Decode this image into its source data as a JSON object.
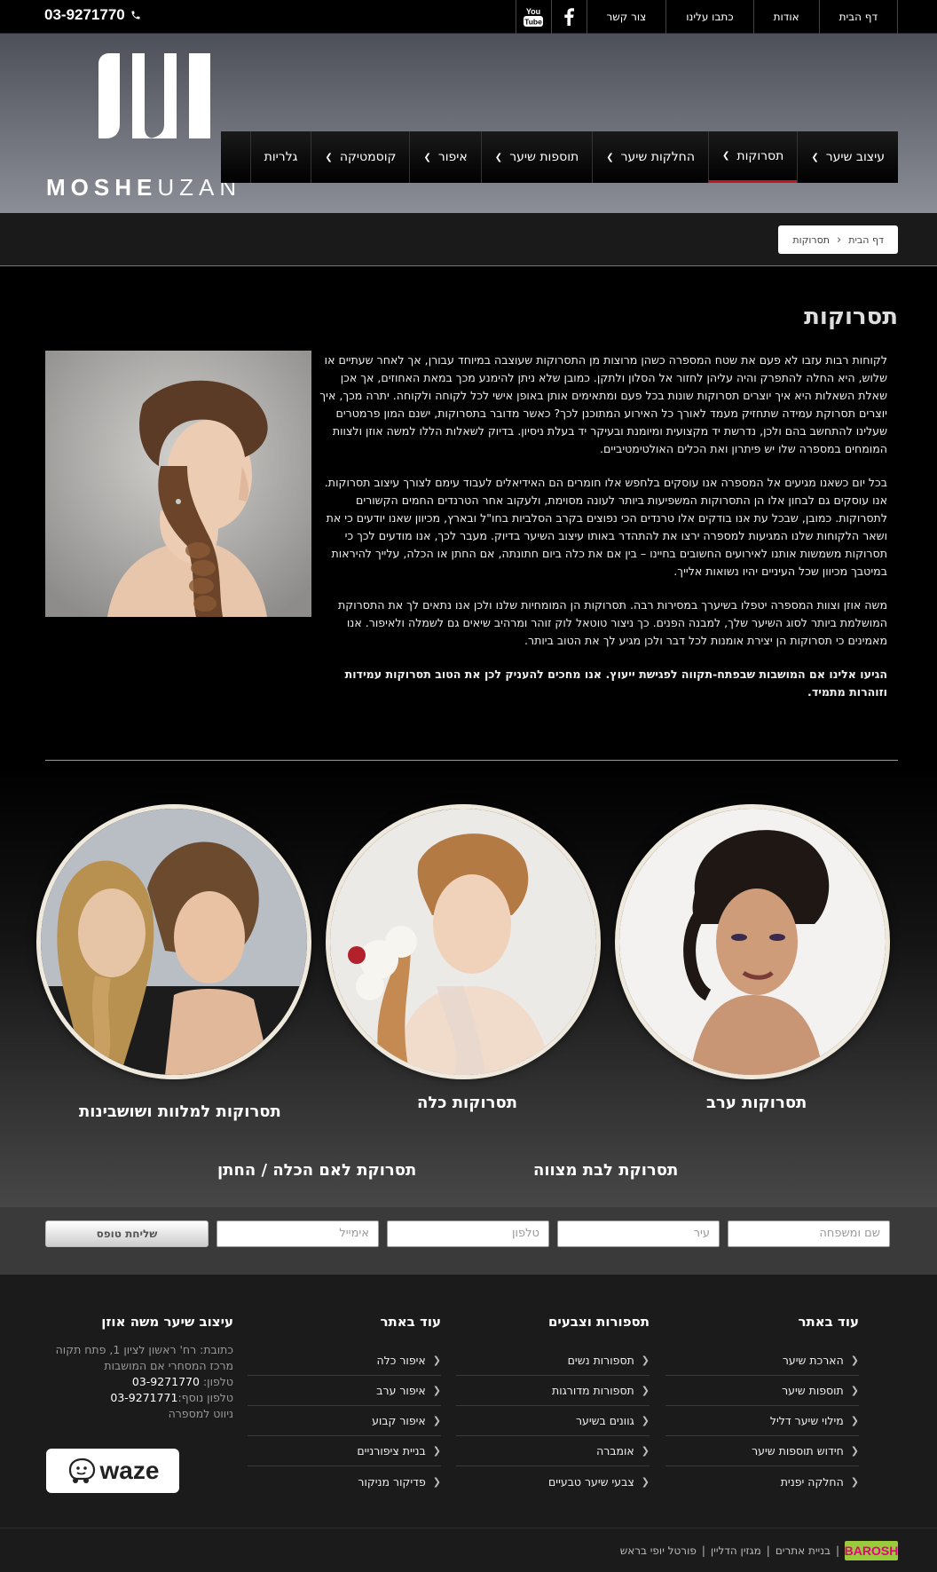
{
  "topbar": {
    "phone": "03-9271770",
    "links": [
      "דף הבית",
      "אודות",
      "כתבו עלינו",
      "צור קשר"
    ],
    "social": [
      "facebook-icon",
      "youtube-icon"
    ]
  },
  "logo": {
    "brand_bold": "MOSHE",
    "brand_thin": "UZAN"
  },
  "mainnav": {
    "items": [
      {
        "label": "עיצוב שיער",
        "has_dropdown": true
      },
      {
        "label": "תסרוקות",
        "has_dropdown": true,
        "active": true
      },
      {
        "label": "החלקות שיער",
        "has_dropdown": true
      },
      {
        "label": "תוספות שיער",
        "has_dropdown": true
      },
      {
        "label": "איפור",
        "has_dropdown": true
      },
      {
        "label": "קוסמטיקה",
        "has_dropdown": true
      },
      {
        "label": "גלריות",
        "has_dropdown": false
      }
    ],
    "active_color": "#c4161c"
  },
  "breadcrumb": {
    "home": "דף הבית",
    "current": "תסרוקות"
  },
  "content": {
    "title": "תסרוקות",
    "paragraphs": [
      "לקוחות רבות עזבו לא פעם את שטח המספרה כשהן מרוצות מן התסרוקות שעוצבה במיוחד עבורן, אך לאחר שעתיים או שלוש, היא החלה להתפרק והיה עליהן לחזור אל הסלון ולתקן. כמובן שלא ניתן להימנע מכך במאת האחוזים, אך אכן שאלת השאלות היא איך יוצרים תסרוקות שונות בכל פעם ומתאימים אותן באופן אישי לכל לקוחה ולקוחה. יתרה מכך, איך יוצרים תסרוקת עמידה שתחזיק מעמד לאורך כל האירוע המתוכנן לכך? כאשר מדובר בתסרוקות, ישנם המון פרמטרים שעלינו להתחשב בהם ולכן, נדרשת יד מקצועית ומיומנת ובעיקר יד בעלת ניסיון. בדיוק לשאלות הללו למשה אוזן ולצוות המומחים במספרה שלו יש פיתרון ואת הכלים האולטימטיביים.",
      "בכל יום כשאנו מגיעים אל המספרה אנו עוסקים בלחפש אלו חומרים הם האידיאלים לעבוד עימם לצורך עיצוב תסרוקות. אנו עוסקים גם לבחון אלו הן התסרוקות המשפיעות ביותר לעונה מסוימת, ולעקוב אחר הטרנדים החמים הקשורים לתסרוקות. כמובן, שבכל עת אנו בודקים אלו טרנדים הכי נפוצים בקרב הסלביות בחו\"ל ובארץ, מכיוון שאנו יודעים כי את ושאר הלקוחות שלנו המגיעות למספרה ירצו את להתהדר באותו עיצוב השיער בדיוק. מעבר לכך, אנו מודעים לכך כי תסרוקות משמשות אותנו לאירועים החשובים בחיינו – בין אם את כלה ביום חתונתה, אם החתן או הכלה, עלייך להיראות במיטבך מכיוון שכל העיניים יהיו נשואות אלייך.",
      "משה אוזן וצוות המספרה יטפלו בשיערך במסירות רבה. תסרוקות הן המומחיות שלנו ולכן אנו נתאים לך את התסרוקת המושלמת ביותר לסוג השיער שלך, למבנה הפנים. כך ניצור טוטאל לוק זוהר ומרהיב שיאים גם לשמלה ולאיפור. אנו מאמינים כי תסרוקות הן יצירת אומנות לכל דבר ולכן מגיע לך את הטוב ביותר.",
      "הגיעו אלינו אם המושבות שבפתח-תקווה לפגישת ייעוץ. אנו מחכים להעניק לכן את הטוב תסרוקות עמידות וזוהרות מתמיד."
    ]
  },
  "gallery": {
    "items": [
      "תסרוקות ערב",
      "תסרוקות כלה",
      "תסרוקות למלוות ושושבינות"
    ],
    "links": [
      "תסרוקת לבת מצווה",
      "תסרוקת לאם הכלה / החתן"
    ]
  },
  "form": {
    "placeholders": [
      "שם ומשפחה",
      "עיר",
      "טלפון",
      "אימייל"
    ],
    "submit": "שליחת טופס"
  },
  "footer": {
    "columns": [
      {
        "title": "עוד באתר",
        "items": [
          "הארכת שיער",
          "תוספות שיער",
          "מילוי שיער דליל",
          "חידוש תוספות שיער",
          "החלקה יפנית"
        ]
      },
      {
        "title": "תספורות וצבעים",
        "items": [
          "תספורות נשים",
          "תספורות מדורגות",
          "גוונים בשיער",
          "אומברה",
          "צבעי שיער טבעיים"
        ]
      },
      {
        "title": "עוד באתר",
        "items": [
          "איפור כלה",
          "איפור ערב",
          "איפור קבוע",
          "בניית ציפורניים",
          "פדיקור מניקור"
        ]
      }
    ],
    "contact": {
      "title": "עיצוב שיער משה אוזן",
      "address": "כתובת: רח' ראשון לציון 1, פתח תקוה",
      "center": "מרכז המסחרי אם המושבות",
      "phone_label": "טלפון:",
      "phone": "03-9271770",
      "phone2_label": "טלפון נוסף:",
      "phone2": "03-9271771",
      "nav_label": "ניווט למספרה",
      "waze": "waze"
    }
  },
  "bottombar": {
    "links": [
      "פורטל יופי בראש",
      "מגזין הדליין",
      "בניית אתרים"
    ],
    "logo": "BAROSH"
  }
}
